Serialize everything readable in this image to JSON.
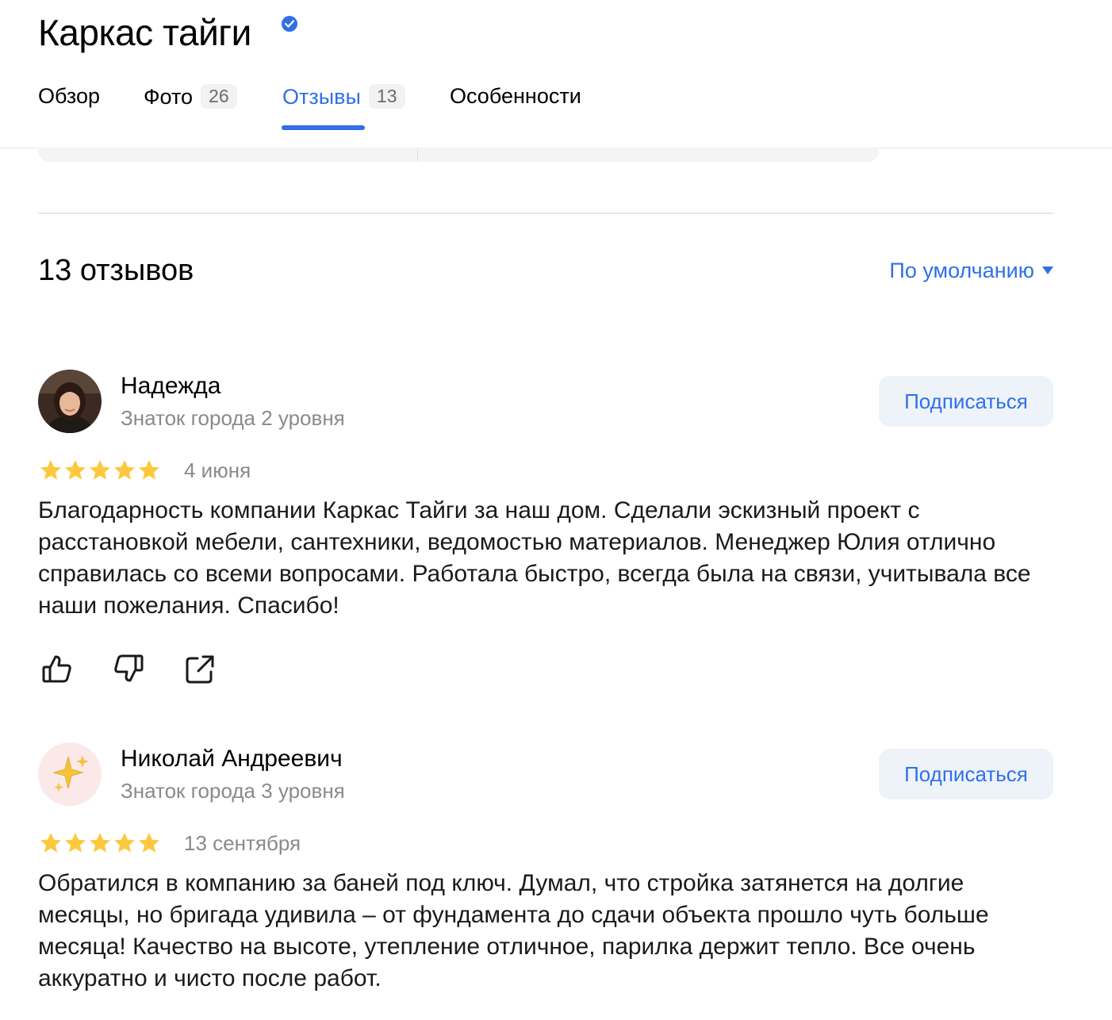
{
  "header": {
    "title": "Каркас тайги",
    "tabs": [
      {
        "label": "Обзор",
        "count": ""
      },
      {
        "label": "Фото",
        "count": "26"
      },
      {
        "label": "Отзывы",
        "count": "13"
      },
      {
        "label": "Особенности",
        "count": ""
      }
    ],
    "active_tab": "Отзывы"
  },
  "reviews_section": {
    "title": "13 отзывов",
    "sort_label": "По умолчанию"
  },
  "reviews": [
    {
      "author": "Надежда",
      "level": "Знаток города 2 уровня",
      "subscribe_label": "Подписаться",
      "rating": 5,
      "date": "4 июня",
      "text": "Благодарность компании Каркас Тайги за наш дом. Сделали эскизный проект с расстановкой мебели, сантехники, ведомостью материалов. Менеджер Юлия отлично справилась со всеми вопросами. Работала быстро, всегда была на связи, учитывала все наши пожелания. Спасибо!"
    },
    {
      "author": "Николай Андреевич",
      "level": "Знаток города 3 уровня",
      "subscribe_label": "Подписаться",
      "rating": 5,
      "date": "13 сентября",
      "text": "Обратился в компанию за баней под ключ. Думал, что стройка затянется на долгие месяцы, но бригада удивила – от фундамента до сдачи объекта прошло чуть больше месяца! Качество на высоте, утепление отличное, парилка держит тепло. Все очень аккуратно и чисто после работ."
    }
  ],
  "icons": {
    "verified": "verified-badge-icon",
    "like": "thumbs-up-icon",
    "dislike": "thumbs-down-icon",
    "share": "share-icon",
    "sort_caret": "caret-down-icon"
  },
  "colors": {
    "accent": "#2f70e8",
    "star": "#fcc83d",
    "muted_text": "#8a8a8a",
    "button_bg": "#eef2f9"
  }
}
